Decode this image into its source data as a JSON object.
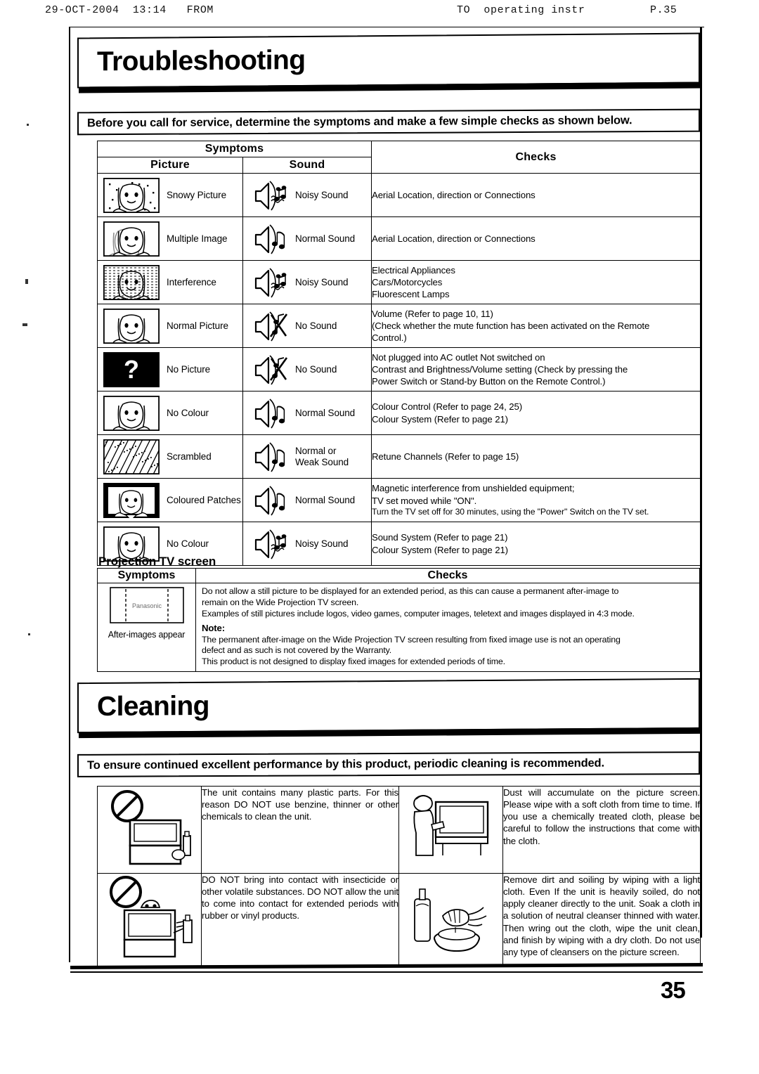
{
  "fax_header": {
    "left": "29-OCT-2004  13:14   FROM",
    "middle": "TO  operating instr",
    "right": "P.35"
  },
  "sections": {
    "troubleshooting": {
      "title": "Troubleshooting",
      "intro": "Before you call for service, determine the symptoms and make a few simple checks as shown below."
    },
    "cleaning": {
      "title": "Cleaning",
      "intro": "To ensure continued excellent performance by this product, periodic cleaning is recommended."
    }
  },
  "main_table": {
    "headers": {
      "symptoms": "Symptoms",
      "picture": "Picture",
      "sound": "Sound",
      "checks": "Checks"
    },
    "rows": [
      {
        "picture_icon": "snowy-picture-icon",
        "picture": "Snowy Picture",
        "sound_icon": "speaker-noisy-icon",
        "sound": "Noisy Sound",
        "checks": [
          "Aerial Location, direction or Connections"
        ]
      },
      {
        "picture_icon": "multiple-image-icon",
        "picture": "Multiple Image",
        "sound_icon": "speaker-normal-icon",
        "sound": "Normal Sound",
        "checks": [
          "Aerial Location, direction or Connections"
        ]
      },
      {
        "picture_icon": "interference-icon",
        "picture": "Interference",
        "sound_icon": "speaker-noisy-icon",
        "sound": "Noisy Sound",
        "checks": [
          "Electrical Appliances",
          "Cars/Motorcycles",
          "Fluorescent Lamps"
        ]
      },
      {
        "picture_icon": "normal-picture-icon",
        "picture": "Normal Picture",
        "sound_icon": "speaker-muted-icon",
        "sound": "No Sound",
        "checks": [
          "Volume (Refer to page 10, 11)",
          "(Check whether the mute function has been activated on the Remote",
          "Control.)"
        ]
      },
      {
        "picture_icon": "no-picture-icon",
        "picture": "No Picture",
        "sound_icon": "speaker-muted-icon",
        "sound": "No Sound",
        "checks": [
          "Not plugged into AC outlet    Not switched on",
          "Contrast and Brightness/Volume setting (Check by pressing the",
          "Power Switch or Stand-by Button on the Remote Control.)"
        ]
      },
      {
        "picture_icon": "no-colour-icon",
        "picture": "No Colour",
        "sound_icon": "speaker-normal-icon",
        "sound": "Normal Sound",
        "checks": [
          "Colour Control (Refer to page 24, 25)",
          "Colour System (Refer to page 21)"
        ]
      },
      {
        "picture_icon": "scrambled-icon",
        "picture": "Scrambled",
        "sound_icon": "speaker-normal-icon",
        "sound": "Normal or\nWeak Sound",
        "checks": [
          "Retune Channels (Refer to page 15)"
        ]
      },
      {
        "picture_icon": "coloured-patches-icon",
        "picture": "Coloured Patches",
        "sound_icon": "speaker-normal-icon",
        "sound": "Normal Sound",
        "checks": [
          "Magnetic interference from unshielded equipment;",
          "TV set moved while \"ON\".",
          "Turn the TV set off for 30 minutes, using the \"Power\" Switch on the TV set."
        ]
      },
      {
        "picture_icon": "no-colour-icon",
        "picture": "No Colour",
        "sound_icon": "speaker-noisy-icon",
        "sound": "Noisy Sound",
        "checks": [
          "Sound System (Refer to page 21)",
          "Colour System (Refer to page 21)"
        ]
      }
    ]
  },
  "projection_table": {
    "title": "Projection TV screen",
    "headers": {
      "symptoms": "Symptoms",
      "checks": "Checks"
    },
    "symptom_icon": "after-image-screen-icon",
    "symptom_icon_text": "Panasonic",
    "symptom_caption": "After-images appear",
    "checks": {
      "para1": [
        "Do not allow a still picture to be displayed for an extended period, as this can cause a permanent after-image to",
        "remain on the Wide Projection TV screen.",
        "Examples of still pictures include logos, video games, computer images, teletext and images displayed in 4:3 mode."
      ],
      "note_label": "Note:",
      "para2": [
        "The permanent after-image on the Wide Projection TV screen resulting from fixed image use is not an operating",
        "defect and as such is not covered by the Warranty.",
        "This product is not designed to display fixed images for extended periods of time."
      ]
    }
  },
  "cleaning_table": {
    "rows": [
      {
        "left_icon": "no-benzine-tv-icon",
        "left_text": "The unit contains many plastic parts. For this reason DO NOT use benzine, thinner or other chemicals to clean the unit.",
        "right_icon": "wipe-screen-cloth-icon",
        "right_text": "Dust will accumulate on the picture screen. Please wipe with a soft cloth from time to time. If you use a chemically treated cloth, please be careful to follow the instructions that come with the cloth."
      },
      {
        "left_icon": "no-insecticide-spray-icon",
        "left_text": "DO NOT bring into contact with insecticide or other volatile substances. DO NOT allow the unit to come into contact for extended periods with rubber or vinyl products.",
        "right_icon": "cloth-in-basin-icon",
        "right_text": "Remove dirt and soiling by wiping with a light cloth. Even If the unit is heavily soiled, do not apply cleaner directly to the unit. Soak a cloth in a solution of neutral cleanser thinned with water. Then wring out the cloth, wipe the unit clean, and finish by wiping with a dry cloth. Do not use any type of cleansers on the picture screen."
      }
    ]
  },
  "page_number": "35"
}
